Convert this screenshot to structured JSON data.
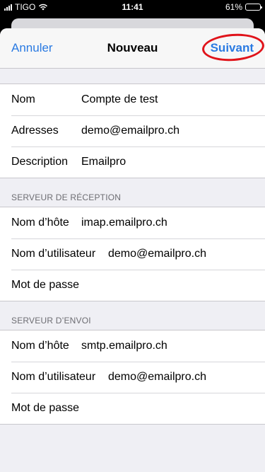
{
  "status": {
    "carrier": "TIGO",
    "time": "11:41",
    "battery": "61%",
    "battery_level": 0.61
  },
  "nav": {
    "cancel": "Annuler",
    "title": "Nouveau",
    "next": "Suivant"
  },
  "account": {
    "rows": [
      {
        "label": "Nom",
        "value": "Compte de test"
      },
      {
        "label": "Adresses",
        "value": "demo@emailpro.ch"
      },
      {
        "label": "Description",
        "value": "Emailpro"
      }
    ]
  },
  "incoming": {
    "header": "SERVEUR DE RÉCEPTION",
    "rows": [
      {
        "label": "Nom d’hôte",
        "value": "imap.emailpro.ch"
      },
      {
        "label": "Nom d’utilisateur",
        "value": "demo@emailpro.ch"
      },
      {
        "label": "Mot de passe",
        "value": ""
      }
    ]
  },
  "outgoing": {
    "header": "SERVEUR D’ENVOI",
    "rows": [
      {
        "label": "Nom d’hôte",
        "value": "smtp.emailpro.ch"
      },
      {
        "label": "Nom d’utilisateur",
        "value": "demo@emailpro.ch"
      },
      {
        "label": "Mot de passe",
        "value": ""
      }
    ]
  },
  "colors": {
    "accent": "#2a7ae2",
    "annotation": "#e0131a",
    "background": "#efeff4"
  }
}
